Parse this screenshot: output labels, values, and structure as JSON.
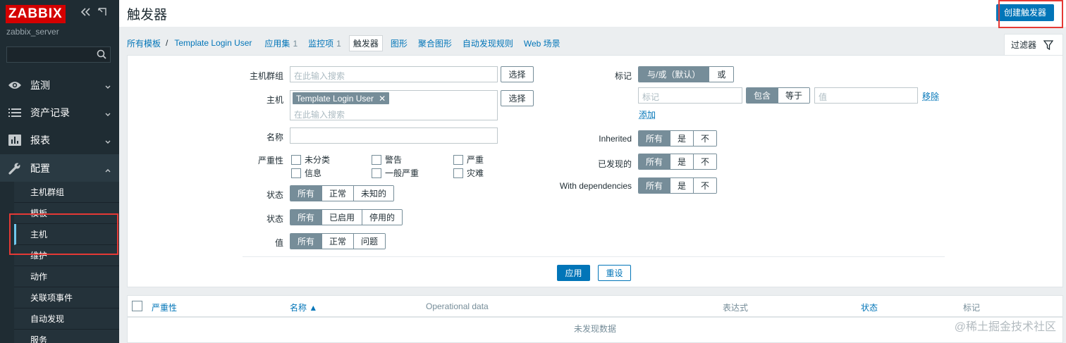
{
  "sidebar": {
    "logo": "ZABBIX",
    "server": "zabbix_server",
    "search_placeholder": "",
    "nav": [
      {
        "label": "监测",
        "icon": "eye-icon"
      },
      {
        "label": "资产记录",
        "icon": "list-icon"
      },
      {
        "label": "报表",
        "icon": "bar-chart-icon"
      },
      {
        "label": "配置",
        "icon": "wrench-icon"
      }
    ],
    "sub": [
      "主机群组",
      "模板",
      "主机",
      "维护",
      "动作",
      "关联项事件",
      "自动发现",
      "服务"
    ]
  },
  "header": {
    "title": "触发器",
    "create_button": "创建触发器"
  },
  "tabs": {
    "all_templates": "所有模板",
    "separator": "/",
    "template": "Template Login User",
    "apps": "应用集",
    "apps_count": "1",
    "items": "监控项",
    "items_count": "1",
    "triggers": "触发器",
    "graphs": "图形",
    "screens": "聚合图形",
    "discovery": "自动发现规则",
    "web": "Web 场景",
    "filter": "过滤器"
  },
  "filter": {
    "host_group_label": "主机群组",
    "host_group_placeholder": "在此输入搜索",
    "select": "选择",
    "host_label": "主机",
    "host_chip": "Template Login User",
    "host_placeholder": "在此输入搜索",
    "name_label": "名称",
    "severity_label": "严重性",
    "severities": [
      "未分类",
      "警告",
      "严重",
      "信息",
      "一般严重",
      "灾难"
    ],
    "state_label": "状态",
    "state_opts": [
      "所有",
      "正常",
      "未知的"
    ],
    "status_label": "状态",
    "status_opts": [
      "所有",
      "已启用",
      "停用的"
    ],
    "value_label": "值",
    "value_opts": [
      "所有",
      "正常",
      "问题"
    ],
    "tags_label": "标记",
    "tags_mode": [
      "与/或（默认）",
      "或"
    ],
    "tag_placeholder": "标记",
    "tag_ops": [
      "包含",
      "等于"
    ],
    "value_placeholder": "值",
    "remove": "移除",
    "add": "添加",
    "inherited_label": "Inherited",
    "yes_no_opts": [
      "所有",
      "是",
      "不"
    ],
    "discovered_label": "已发现的",
    "deps_label": "With dependencies",
    "apply": "应用",
    "reset": "重设"
  },
  "table": {
    "columns": [
      "严重性",
      "名称 ▲",
      "Operational data",
      "表达式",
      "状态",
      "标记"
    ],
    "empty": "未发现数据"
  },
  "watermark": "@稀土掘金技术社区",
  "colors": {
    "accent": "#0275b8",
    "sidebar": "#1f2c33",
    "logo": "#d40000",
    "highlight": "#e53935"
  }
}
